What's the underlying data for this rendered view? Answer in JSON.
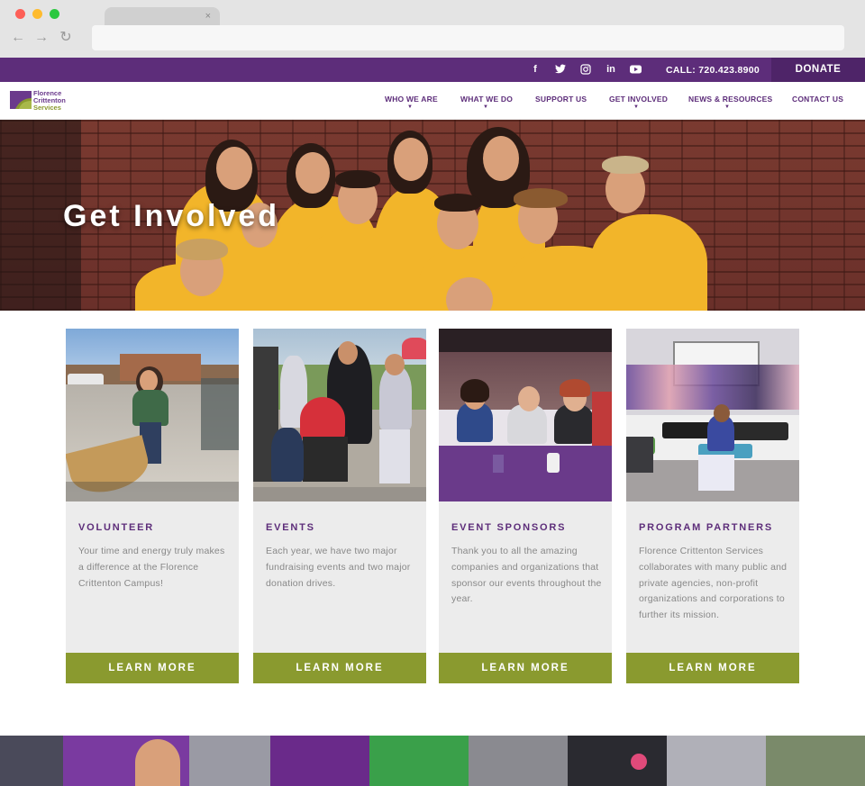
{
  "browser": {
    "tab_close": "×",
    "back": "←",
    "forward": "→",
    "reload": "↻"
  },
  "topbar": {
    "social": [
      "f",
      "t",
      "◎",
      "in",
      "▶"
    ],
    "social_icons": [
      "facebook-icon",
      "twitter-icon",
      "instagram-icon",
      "linkedin-icon",
      "youtube-icon"
    ],
    "call": "CALL: 720.423.8900",
    "donate": "DONATE"
  },
  "logo": {
    "line1": "Florence",
    "line2": "Crittenton",
    "line3": "Services"
  },
  "nav": {
    "items": [
      {
        "label": "WHO WE ARE",
        "caret": "▼"
      },
      {
        "label": "WHAT WE DO",
        "caret": "▼"
      },
      {
        "label": "SUPPORT US",
        "caret": ""
      },
      {
        "label": "GET INVOLVED",
        "caret": "▼"
      },
      {
        "label": "NEWS & RESOURCES",
        "caret": "▼"
      },
      {
        "label": "CONTACT US",
        "caret": ""
      }
    ]
  },
  "hero": {
    "title": "Get Involved"
  },
  "cards": [
    {
      "title": "VOLUNTEER",
      "text": "Your time and energy truly makes a difference at the Florence Crittenton Campus!",
      "button": "LEARN MORE"
    },
    {
      "title": "EVENTS",
      "text": "Each year, we have two major fundraising events and two major donation drives.",
      "button": "LEARN MORE"
    },
    {
      "title": "EVENT SPONSORS",
      "text": "Thank you to all the amazing companies and organizations that sponsor our events throughout the year.",
      "button": "LEARN MORE"
    },
    {
      "title": "PROGRAM PARTNERS",
      "text": "Florence Crittenton Services collaborates with many public and private agencies, non-profit organizations and corporations to further its mission.",
      "button": "LEARN MORE"
    }
  ],
  "colors": {
    "brand_purple": "#5d2d7a",
    "donate_purple": "#4e2468",
    "olive_button": "#8a9a2f",
    "card_bg": "#ececec"
  }
}
